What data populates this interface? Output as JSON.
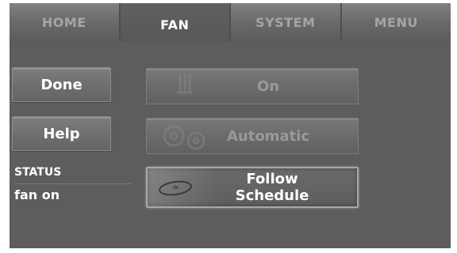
{
  "tabs": [
    {
      "label": "HOME",
      "active": false
    },
    {
      "label": "FAN",
      "active": true
    },
    {
      "label": "SYSTEM",
      "active": false
    },
    {
      "label": "MENU",
      "active": false
    }
  ],
  "side_buttons": {
    "done": "Done",
    "help": "Help"
  },
  "status": {
    "label": "STATUS",
    "value": "fan on"
  },
  "fan_options": {
    "on": "On",
    "automatic": "Automatic",
    "follow_line1": "Follow",
    "follow_line2": "Schedule",
    "selected": "Follow Schedule"
  },
  "icons": {
    "on": "fan-on-icon",
    "automatic": "gears-icon",
    "follow": "clock-schedule-icon"
  },
  "colors": {
    "screen_bg": "#5d5d5d",
    "active_text": "#ffffff",
    "inactive_text": "#a5a5a5",
    "disabled_text": "#9a9a9a"
  }
}
